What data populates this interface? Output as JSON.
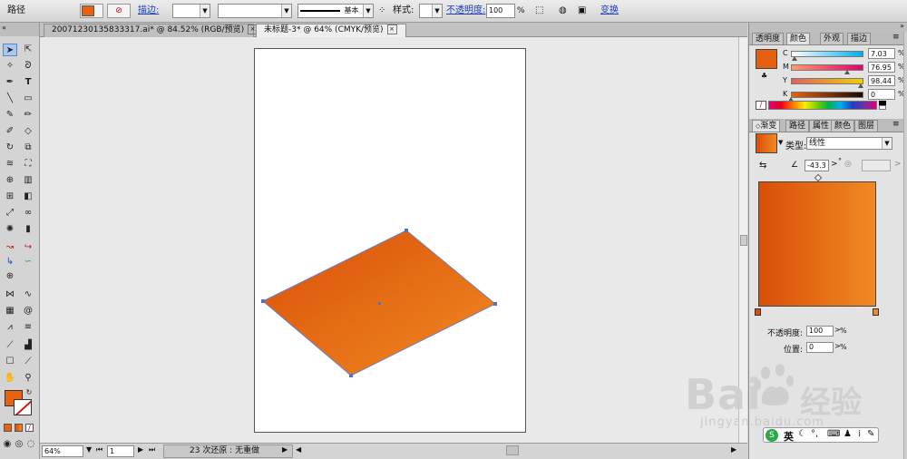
{
  "control_bar": {
    "object_type": "路径",
    "fill_color": "#e8620f",
    "stroke_label": "描边:",
    "brush_label": "基本",
    "style_label": "样式:",
    "opacity_label": "不透明度:",
    "opacity_value": "100",
    "opacity_unit": "%",
    "transform_label": "变换"
  },
  "doc_tabs": [
    {
      "label": "20071230135833317.ai* @ 84.52% (RGB/预览)"
    },
    {
      "label": "未标题-3* @ 64% (CMYK/预览)"
    }
  ],
  "status_bar": {
    "zoom": "64%",
    "page": "1",
    "undo_text": "23 次还原 : 无重做"
  },
  "color_panel": {
    "tabs": [
      "透明度",
      "颜色",
      "外观",
      "描边"
    ],
    "active_tab": "颜色",
    "swatch_color": "#e36010",
    "channels": [
      {
        "name": "C",
        "value": "7.03"
      },
      {
        "name": "M",
        "value": "76.95"
      },
      {
        "name": "Y",
        "value": "98.44"
      },
      {
        "name": "K",
        "value": "0"
      }
    ],
    "unit": "%"
  },
  "gradient_panel": {
    "tabs": [
      "渐变",
      "路径",
      "属性",
      "颜色",
      "图层"
    ],
    "active_tab": "渐变",
    "type_label": "类型:",
    "type_value": "线性",
    "angle_value": "-43.3",
    "degree_symbol": "°",
    "gradient_start": "#d94f08",
    "gradient_end": "#f08a22",
    "opacity_label": "不透明度:",
    "opacity_value": "100",
    "location_label": "位置:",
    "location_value": "0",
    "unit": "%"
  },
  "watermark": {
    "brand": "Bai",
    "brand2": "经验",
    "url": "jingyan.baidu.com"
  },
  "ime_toolbar": {
    "lang": "英"
  },
  "artwork": {
    "shape_gradient_start": "#d94f08",
    "shape_gradient_end": "#f08a22",
    "anchor_color": "#5570c8"
  }
}
